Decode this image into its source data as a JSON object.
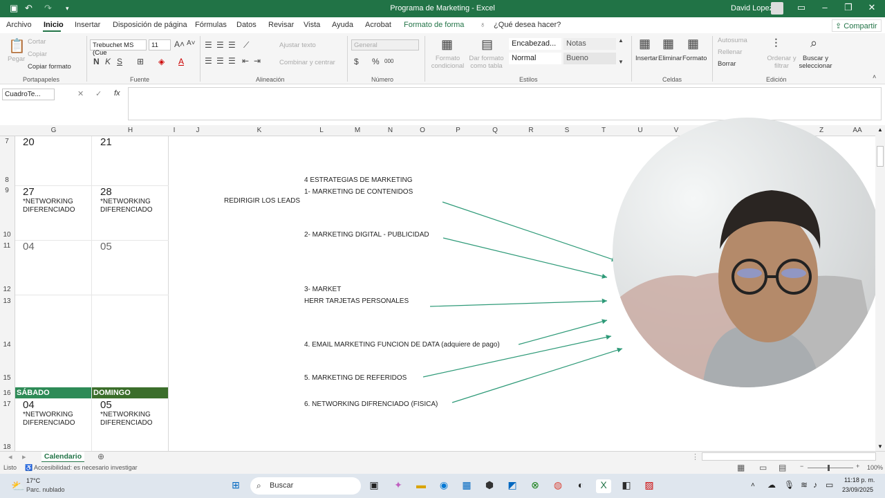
{
  "window": {
    "title": "Programa de Marketing  -  Excel",
    "user": "David Lopez"
  },
  "menu": {
    "items": [
      "Archivo",
      "Inicio",
      "Insertar",
      "Disposición de página",
      "Fórmulas",
      "Datos",
      "Revisar",
      "Vista",
      "Ayuda",
      "Acrobat",
      "Formato de forma"
    ],
    "search": "¿Qué desea hacer?",
    "share": "Compartir"
  },
  "ribbon": {
    "clipboard": {
      "paste": "Pegar",
      "cut": "Cortar",
      "copy": "Copiar",
      "format_painter": "Copiar formato",
      "group": "Portapapeles"
    },
    "font": {
      "name": "Trebuchet MS (Cue",
      "size": "11",
      "group": "Fuente"
    },
    "alignment": {
      "wrap": "Ajustar texto",
      "merge": "Combinar y centrar",
      "group": "Alineación"
    },
    "number": {
      "format": "General",
      "group": "Número"
    },
    "styles": {
      "cond_format": "Formato condicional",
      "as_table": "Dar formato como tabla",
      "s1": "Encabezad...",
      "s2": "Notas",
      "s3": "Normal",
      "s4": "Bueno",
      "group": "Estilos"
    },
    "cells": {
      "insert": "Insertar",
      "delete": "Eliminar",
      "format": "Formato",
      "group": "Celdas"
    },
    "editing": {
      "autosum": "Autosuma",
      "fill": "Rellenar",
      "clear": "Borrar",
      "sort": "Ordenar y filtrar",
      "find": "Buscar y seleccionar",
      "group": "Edición"
    }
  },
  "formula": {
    "namebox": "CuadroTe...",
    "value": ""
  },
  "columns": [
    "G",
    "H",
    "I",
    "J",
    "K",
    "L",
    "M",
    "N",
    "O",
    "P",
    "Q",
    "R",
    "S",
    "T",
    "U",
    "V",
    "Z",
    "AA"
  ],
  "rows": [
    "7",
    "8",
    "9",
    "10",
    "11",
    "12",
    "13",
    "14",
    "15",
    "16",
    "17",
    "18"
  ],
  "calendar": {
    "r7": {
      "g": "20",
      "h": "21"
    },
    "r9": {
      "g": "27",
      "h": "28",
      "note": "*NETWORKING DIFERENCIADO"
    },
    "r11": {
      "g": "04",
      "h": "05"
    },
    "r16": {
      "sat": "SÁBADO",
      "sun": "DOMINGO"
    },
    "r17": {
      "g": "04",
      "h": "05",
      "note": "*NETWORKING DIFERENCIADO"
    }
  },
  "notes": {
    "redirect": "REDIRIGIR LOS LEADS",
    "title": "4 ESTRATEGIAS DE MARKETING",
    "s1": "1- MARKETING DE CONTENIDOS",
    "s2": "2- MARKETING DIGITAL - PUBLICIDAD",
    "s3a": "3- MARKET",
    "s3b": "HERR TARJETAS PERSONALES",
    "s4": "4. EMAIL MARKETING FUNCION DE DATA (adquiere de pago)",
    "s5": "5. MARKETING DE REFERIDOS",
    "s6": "6. NETWORKING DIFRENCIADO (FISICA)"
  },
  "sheet_tab": "Calendario",
  "status": {
    "ready": "Listo",
    "accessibility": "Accesibilidad: es necesario investigar",
    "zoom": "100%"
  },
  "taskbar": {
    "weather_temp": "17°C",
    "weather_desc": "Parc. nublado",
    "search": "Buscar",
    "time": "11:18 p. m.",
    "date": "23/09/2025"
  },
  "colors": {
    "excel_green": "#217346",
    "saturday": "#2e8b57",
    "sunday": "#3b6e2b",
    "arrow": "#2e9a78"
  }
}
